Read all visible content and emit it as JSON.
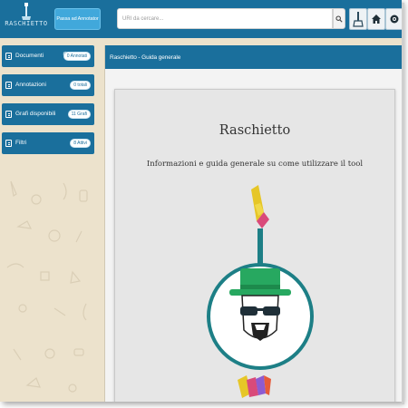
{
  "header": {
    "logo_text": "RASCHIETTO",
    "annotator_button_label": "Passa ad Annotator",
    "search_placeholder": "URI da cercare...",
    "nav_icons": [
      "search-icon",
      "broom-icon",
      "home-icon",
      "eye-icon"
    ]
  },
  "sidebar": {
    "items": [
      {
        "label": "Documenti",
        "badge": "0 Annotati",
        "icon": "document-icon",
        "extra_icon": "gear-icon"
      },
      {
        "label": "Annotazioni",
        "badge": "0 totali",
        "icon": "document-icon"
      },
      {
        "label": "Grafi disponibili",
        "badge": "11 Grafi",
        "icon": "document-icon"
      },
      {
        "label": "Filtri",
        "badge": "8 Attivi",
        "icon": "document-icon"
      }
    ]
  },
  "main": {
    "breadcrumb": "Raschietto - Guida generale",
    "title": "Raschietto",
    "subtitle": "Informazioni e guida generale su come utilizzare il tool",
    "image_icon": "mascot-logo"
  },
  "colors": {
    "header_blue": "#1a6f9c",
    "button_blue": "#41a8db",
    "beige_bg": "#ece2cc",
    "panel_bg": "#f3f3f3",
    "card_bg": "#e6e6e6",
    "hat_green": "#27a860",
    "ring_teal": "#1d7f86"
  }
}
